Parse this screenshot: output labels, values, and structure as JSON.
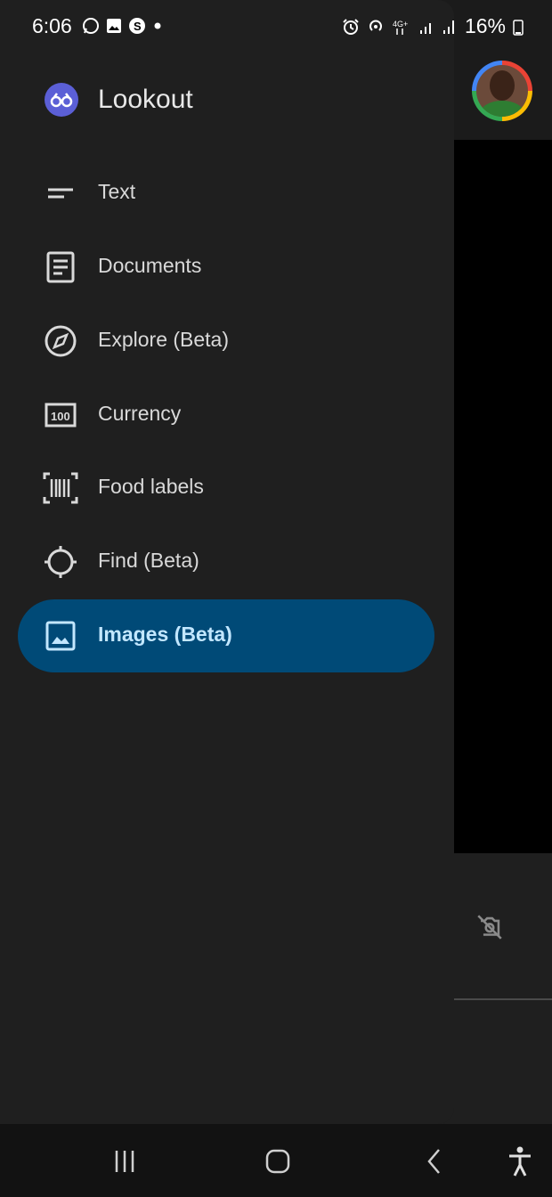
{
  "status_bar": {
    "time": "6:06",
    "battery": "16%",
    "left_icons": [
      "whatsapp-icon",
      "gallery-icon",
      "skype-icon",
      "dot-icon"
    ],
    "right_icons": [
      "alarm-icon",
      "hotspot-icon",
      "4g-icon",
      "signal-icon",
      "signal-icon",
      "battery-icon"
    ]
  },
  "drawer": {
    "app_title": "Lookout",
    "items": [
      {
        "label": "Text",
        "icon": "text-lines-icon",
        "active": false
      },
      {
        "label": "Documents",
        "icon": "document-icon",
        "active": false
      },
      {
        "label": "Explore (Beta)",
        "icon": "compass-icon",
        "active": false
      },
      {
        "label": "Currency",
        "icon": "currency-icon",
        "active": false
      },
      {
        "label": "Food labels",
        "icon": "barcode-icon",
        "active": false
      },
      {
        "label": "Find (Beta)",
        "icon": "crosshair-icon",
        "active": false
      },
      {
        "label": "Images (Beta)",
        "icon": "image-icon",
        "active": true
      }
    ]
  },
  "colors": {
    "drawer_bg": "#1f1f1f",
    "active_bg": "#004a77",
    "active_text": "#c2e7ff",
    "brand": "#5b5fd6"
  },
  "navbar": {
    "icons": [
      "recents-icon",
      "home-icon",
      "back-icon",
      "accessibility-icon"
    ]
  }
}
